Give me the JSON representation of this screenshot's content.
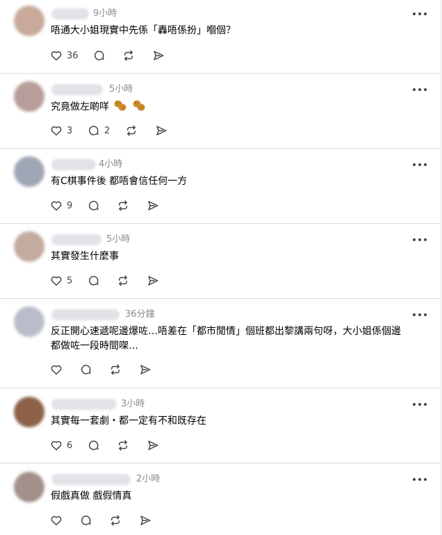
{
  "comments": [
    {
      "time": "9小時",
      "text": "唔通大小姐現實中先係「轟唔係扮」嗰個？",
      "likes": "36",
      "replies": "",
      "avatar_color": "#c8a99a"
    },
    {
      "time": "5小時",
      "text": "究竟做左啲咩",
      "likes": "3",
      "replies": "2",
      "avatar_color": "#b89e9a",
      "emoji": [
        "peanut-emoji",
        "peanut-emoji"
      ]
    },
    {
      "time": "4小時",
      "text": "有C棋事件後 都唔會信任何一方",
      "likes": "9",
      "replies": "",
      "avatar_color": "#9fa6b6"
    },
    {
      "time": "5小時",
      "text": "其實發生什麼事",
      "likes": "5",
      "replies": "",
      "avatar_color": "#c4aba0"
    },
    {
      "time": "36分鐘",
      "text": "反正開心速遞呢邊爆咗…唔差在「都市閒情」個班都出黎講兩句呀，大小姐係個邊",
      "text2": "都做咗一段時間㗎…",
      "likes": "",
      "replies": "",
      "avatar_color": "#b9bdc9"
    },
    {
      "time": "3小時",
      "text": "其實每一套劇・都一定有不和既存在",
      "likes": "6",
      "replies": "",
      "avatar_color": "#8d6048"
    },
    {
      "time": "2小時",
      "text": "假戲真做 戲假情真",
      "likes": "",
      "replies": "",
      "avatar_color": "#a2908a"
    }
  ],
  "colors": {
    "icon": "#444444",
    "time": "#8a8a8a",
    "divider": "#dcdcdc"
  },
  "icons": [
    "heart-icon",
    "comment-icon",
    "repost-icon",
    "share-icon",
    "more-icon"
  ]
}
